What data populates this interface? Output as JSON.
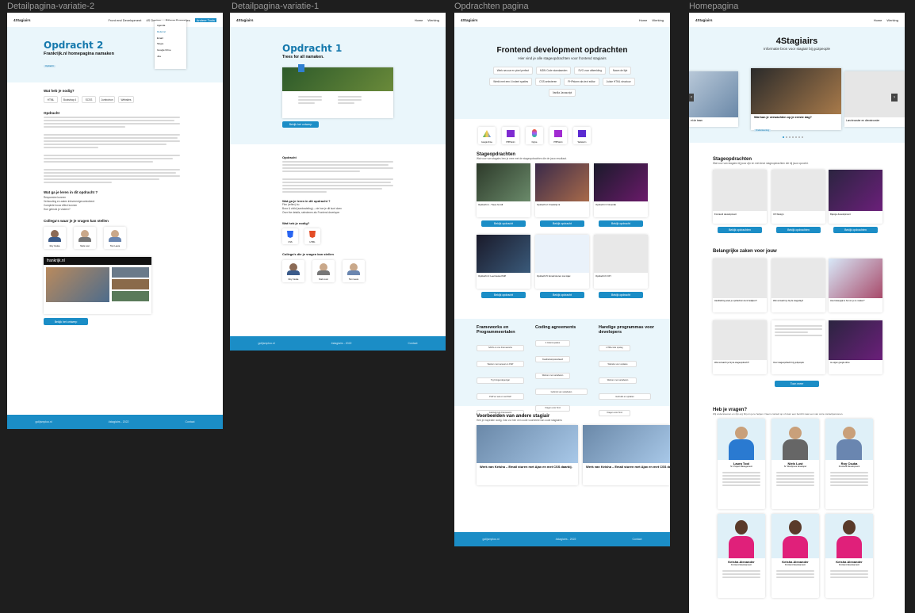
{
  "frames": {
    "f1": {
      "label": "Detailpagina-variatie-2"
    },
    "f2": {
      "label": "Detailpagina-variatie-1"
    },
    "f3": {
      "label": "Opdrachten pagina"
    },
    "f4": {
      "label": "Homepagina"
    }
  },
  "f1": {
    "logo": "4Stagiairs",
    "nav": [
      "Front end Development",
      "4S Design",
      "Bijlage Bonnetjes",
      "Andere Tools"
    ],
    "dropdown": [
      "Agenda",
      "Referral",
      "Email",
      "Skype",
      "Google Drive",
      "Jira"
    ],
    "title": "Opdracht 2",
    "subtitle": "Frankrijk.nl homepagina namaken",
    "tag": "Opdracht",
    "need_heading": "Wat heb je nodig?",
    "need_chips": [
      "HTML",
      "Bootstrap 4",
      "SCSS",
      "Jumbotron",
      "Websites"
    ],
    "intro_heading": "Opdracht",
    "learn_heading": "Wat ga je leren in dit opdracht ?",
    "learn_items": [
      "Responsive kunnen",
      "Verhouding en zaken inleveren/gecontroleerd",
      "Complete bouw effect kunnen",
      "Hoe gebruik je vindeer?"
    ],
    "colleagues_heading": "Collega's waar je je vragen kan stellen",
    "colleagues": [
      "Roy Csuka",
      "Niels Lust",
      "Tom Laura"
    ],
    "site_logo": "frankrijk.nl",
    "cta": "Bekijk het ontwerp",
    "footer": [
      "golijsmploo.nl",
      "4stagiairs - 2022",
      "Contact"
    ]
  },
  "f2": {
    "logo": "4Stagiairs",
    "nav": [
      "Home",
      "Werking"
    ],
    "title": "Opdracht 1",
    "subtitle": "Trees for all namaken.",
    "cta": "Bekijk het ontwerp",
    "intro_heading": "Opdracht",
    "learn_heading": "Wat ga je leren in dit opdracht ?",
    "learn_items": [
      "Flex (reflex)-hu",
      "Boxx & child (aanbosteling) – zie hoe je dit kunt doen",
      "Over the details, selecteren als Frontend developer"
    ],
    "need_heading": "Wat heb je nodig?",
    "need_icons": [
      "CSS",
      "HTML"
    ],
    "colleagues_heading": "Collega's die je vragen kan stellen",
    "colleagues": [
      "Roy Csuka",
      "Niels Lust",
      "Tom Laura"
    ],
    "footer": [
      "golijsmploo.nl",
      "4stagiairs - 2022",
      "Contact"
    ]
  },
  "f3": {
    "logo": "4Stagiairs",
    "nav": [
      "Home",
      "Werking"
    ],
    "title": "Frontend development opdrachten",
    "subtitle": "Hier vind je alle stageopdrachten voor frontend stagiairs",
    "chips": [
      "Werk secuur en pixel perfect",
      "MDN Code standaarden",
      "SVG voor afbeelding",
      "Naam de lijst",
      "Werkt met een 4 indent spaties",
      "CSS selecteren",
      "PHPstorm als text editor",
      "Juiste HTML structuur",
      "Vanilla Javascript"
    ],
    "tools": [
      "Google Drive",
      "PHPStorm",
      "Figma",
      "PHPStorm",
      "Webstorm"
    ],
    "assign_heading": "Stageopdrachten",
    "assign_sub": "Wat voor van stagairs ben je mee met de stageopdrachten die de jouw resultaat.",
    "assignments": [
      "Opdracht 1 - Trees for All",
      "Opdracht 2: Frankrijk.nl",
      "Opdracht 3: Nmeridk",
      "Opdracht 4: Leerroutes PHP",
      "Opdracht 5: Email sturen met Ajax",
      "Opdracht 6: DIY"
    ],
    "view_btn": "Bekijk opdracht",
    "col_headings": [
      "Frameworks en Programmeertalen",
      "Coding agreements",
      "Handige programmas voor developers"
    ],
    "col1": [
      "SASS en css Frameworks",
      "Werken met Laravel en PHP",
      "Trg bringendeperigar",
      "PHP en wat er met PHP",
      "Gebruik hulp Framework"
    ],
    "col2": [
      "4 Indent spaties",
      "Kwaliteitstopstandaard",
      "Werken met variabelen",
      "Gebruik van variabelen",
      "Vragen voor html"
    ],
    "col3": [
      "HTMLcode opslag",
      "Website voor updates",
      "Werken met variabelen",
      "Gebruikt en updaten",
      "Vragen voor html"
    ],
    "examples_heading": "Voorbeelden van andere stagiair",
    "examples_sub": "Heb je inspiratie nodig. Dan zul hier een oude voorbeeld van oude stagiaires",
    "examples": [
      "Werk van Keisha – Email sturen met Ajax en met CSS daarbij.",
      "Werk van Keisha – Email sturen met Ajax en met CSS daarbij."
    ],
    "footer": [
      "golijsmploo.nl",
      "4stagiairs - 2022",
      "Contact"
    ]
  },
  "f4": {
    "logo": "4Stagiairs",
    "nav": [
      "Home",
      "Werking"
    ],
    "title": "4Stagiairs",
    "subtitle": "Informatie bron voor stagiair bij go2people",
    "slides": [
      "et de team",
      "Wat kan je verwachten op je eerste dag?",
      "Lunchrooster en dienstrooster"
    ],
    "slide_tag": "Ondersteuning",
    "assign_heading": "Stageopdrachten",
    "assign_sub": "Wat voor van stagairs bij jouw zijn en met deze stageopdrachten die bij jouw opzoekt.",
    "assignments": [
      "Frontend development",
      "UX Design",
      "Django development"
    ],
    "view_btn": "Bekijk opdrachten",
    "important_heading": "Belangrijke zaken voor jouw",
    "important": [
      "Handleiding waar je opdrachten kunt bekijken?",
      "Wat verwacht je bij de stagedag?",
      "Hoe belangrijk is het om je te maken?",
      "Wat verwacht je bij de stageopdracht?",
      "Over stageopdracht bij go2people",
      "Je eigen google drive"
    ],
    "more_btn": "Toon meer",
    "questions_heading": "Heb je vragen?",
    "questions_sub": "Wij ondersteunen en zijn erg blij om je te helpen. Neem contact op of stuur een bericht naar een van onze contactpersonen.",
    "people": [
      {
        "name": "Laura Tool",
        "role": "Sr. Project Management"
      },
      {
        "name": "Niels Lust",
        "role": "Sr. Wordpress developer"
      },
      {
        "name": "Roy Csuka",
        "role": "Frontend Development"
      },
      {
        "name": "Keisha Alexander",
        "role": "Frontend development"
      },
      {
        "name": "Keisha Alexander",
        "role": "Frontend development"
      },
      {
        "name": "Keisha Alexander",
        "role": "Frontend development"
      }
    ]
  }
}
